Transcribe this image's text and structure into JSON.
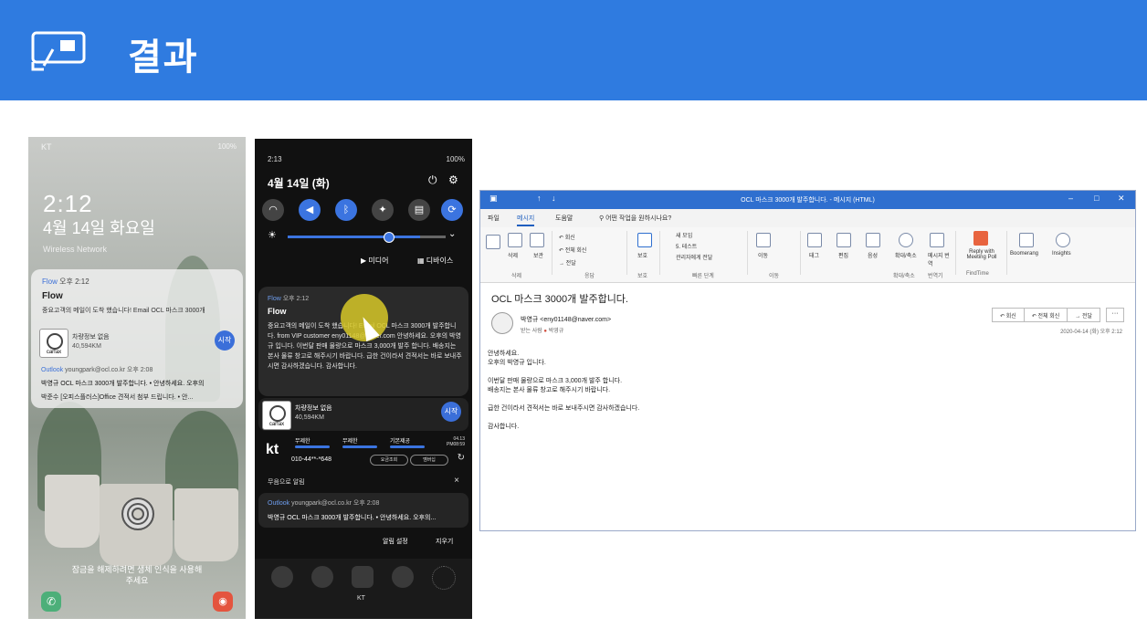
{
  "header": {
    "title": "결과",
    "bg": "#2f7be0"
  },
  "phone1": {
    "carrier": "KT",
    "status_right": "100%",
    "time": "2:12",
    "date": "4월 14일 화요일",
    "network": "Wireless Network",
    "notif_meta_app": "Flow",
    "notif_meta_time": "오후 2:12",
    "notif_title": "Flow",
    "notif_body": "중요고객의 메일이 도착 했습니다! Email OCL 마스크 3000개",
    "car_title": "차량정보 없음",
    "car_km": "40,594KM",
    "start_btn": "시작",
    "carfax": "carfax",
    "outlook_app": "Outlook",
    "outlook_from": "youngpark@ocl.co.kr",
    "outlook_time": "오후 2:08",
    "mail1": "박영규 OCL 마스크 3000개 발주합니다. • 안녕하세요. 오후의",
    "mail2": "박준수 [오피스플러스]Office 견적서 첨부 드립니다. • 안...",
    "unlock_text_1": "잠금을 해제하려면 생체 인식을 사용해",
    "unlock_text_2": "주세요",
    "phone_icon": "phone-icon",
    "camera_icon": "camera-icon"
  },
  "phone2": {
    "time": "2:13",
    "status_right": "100%",
    "date": "4월 14일 (화)",
    "media_label": "미디어",
    "device_label": "디바이스",
    "notif_meta_app": "Flow",
    "notif_meta_time": "오후 2:12",
    "notif_title": "Flow",
    "notif_body": "중요고객의 메일이 도착 했습니다! Email OCL 마스크 3000개 발주합니다. from VIP customer eny01148@naver.com 안녕하세요. 오후의 박영규 입니다. 이번달 판매 물량으로 마스크 3,000개 발주 합니다. 배송지는 본사 물류 창고로 해주시기 바랍니다. 급한 건이라서 견적서는 바로 보내주시면 감사하겠습니다. 감사합니다.",
    "car_title": "차량정보 없음",
    "car_km": "40,594KM",
    "start_btn": "시작",
    "carfax": "carfax",
    "kt_logo": "kt",
    "kt_cols": [
      "무제한",
      "무제한",
      "기본제공"
    ],
    "kt_number": "010-44**-*648",
    "kt_btn1": "요금조회",
    "kt_btn2": "멤버십",
    "kt_time": "04.13 PM08:59",
    "silent_label": "무음으로 알림",
    "mail_app": "Outlook",
    "mail_from": "youngpark@ocl.co.kr",
    "mail_time": "오후 2:08",
    "mail_line": "박영규 OCL 마스크 3000개 발주합니다. • 안녕하세요. 오후의...",
    "alarm_settings": "알림 설정",
    "clear": "지우기",
    "dock_label": "KT"
  },
  "outlook": {
    "window_title": "OCL 마스크 3000개 발주합니다. - 메시지 (HTML)",
    "tabs": [
      "파일",
      "메시지",
      "도움말"
    ],
    "tell_me": "어떤 작업을 원하시나요?",
    "ribbon": {
      "delete": "삭제",
      "archive": "보관",
      "reply": "회신",
      "reply_all": "전체 회신",
      "forward": "전달",
      "group_delete": "삭제",
      "group_respond": "응답",
      "protect": "보호",
      "group_protect": "보호",
      "quick1": "새 모임",
      "quick2": "5. 테스트",
      "quick3": "관리자에게 전달",
      "group_quick": "빠른 단계",
      "move": "이동",
      "group_move": "이동",
      "tags": "태그",
      "edit": "편집",
      "voice": "음성",
      "zoom": "확대/축소",
      "group_zoom": "확대/축소",
      "translate": "메시지 번역",
      "group_translate": "번역기",
      "reply_meeting": "Reply with Meeting Poll",
      "group_findtime": "FindTime",
      "boomerang": "Boomerang",
      "insights": "Insights"
    },
    "subject": "OCL 마스크 3000개 발주합니다.",
    "from": "박영규 <eny01148@naver.com>",
    "to_label": "받는 사람",
    "to_name": "박영규",
    "btn_reply": "회신",
    "btn_reply_all": "전체 회신",
    "btn_forward": "전달",
    "date": "2020-04-14 (화) 오후 2:12",
    "body": [
      "안녕하세요.",
      "오후의 박영규 입니다.",
      "",
      "이번달 판매 물량으로 마스크 3,000개 발주 합니다.",
      "배송지는 본사 물류 창고로 해주시기 바랍니다.",
      "",
      "급한 건이라서 견적서는 바로 보내주시면 감사하겠습니다.",
      "",
      "감사합니다."
    ]
  }
}
